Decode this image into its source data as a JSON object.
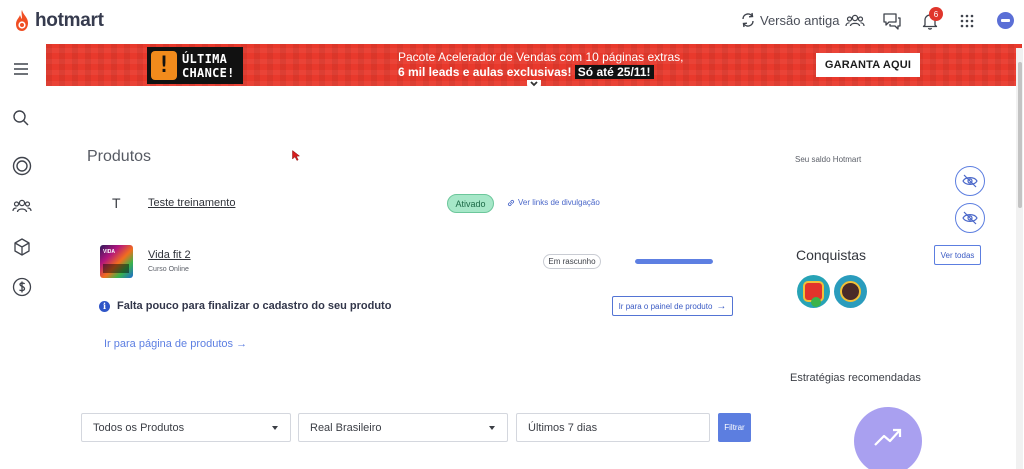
{
  "header": {
    "logo_text": "hotmart",
    "old_version_label": "Versão antiga",
    "notification_count": "6"
  },
  "banner": {
    "badge_line1": "ÚLTIMA",
    "badge_line2": "CHANCE!",
    "line1": "Pacote Acelerador de Vendas com 10 páginas extras,",
    "line2_bold": "6 mil leads e aulas exclusivas!",
    "line2_highlight": "Só até 25/11!",
    "cta_label": "GARANTA AQUI"
  },
  "main": {
    "title": "Produtos",
    "products": [
      {
        "initial": "T",
        "name": "Teste treinamento",
        "status": "Ativado",
        "link_label": "Ver links de divulgação"
      },
      {
        "thumb_text": "VIDA",
        "name": "Vida fit 2",
        "subtitle": "Curso Online",
        "status": "Em rascunho",
        "progress": 1.0
      }
    ],
    "info_message": "Falta pouco para finalizar o cadastro do seu produto",
    "panel_button_label": "Ir para o painel de produto",
    "products_page_link": "Ir para página de produtos"
  },
  "filters": {
    "products_select": "Todos os Produtos",
    "currency_select": "Real Brasileiro",
    "period_select": "Últimos 7 dias",
    "filter_button": "Filtrar"
  },
  "right": {
    "balance_label": "Seu saldo Hotmart",
    "achievements_title": "Conquistas",
    "see_all_label": "Ver todas",
    "strategies_label": "Estratégias recomendadas"
  },
  "colors": {
    "brand": "#f04e23",
    "banner": "#e9392c",
    "primary": "#5c7ee0",
    "active_badge": "#a6e7c8"
  },
  "icons": {
    "sidebar": [
      "menu-icon",
      "search-icon",
      "target-icon",
      "users-icon",
      "cube-icon",
      "dollar-icon"
    ],
    "header": [
      "refresh-icon",
      "community-icon",
      "chat-icon",
      "bell-icon",
      "apps-grid-icon"
    ]
  }
}
